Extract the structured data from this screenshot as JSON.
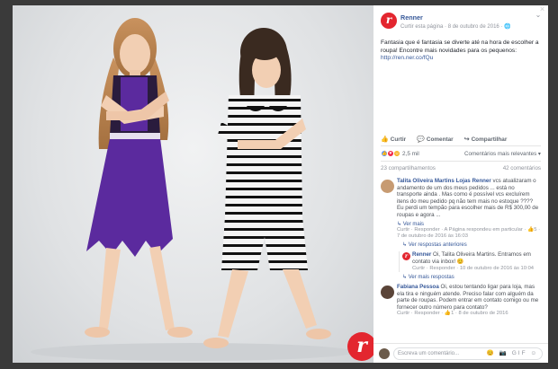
{
  "post": {
    "page_name": "Renner",
    "meta": "Curtir esta página · 8 de outubro de 2016 · ",
    "text_prefix": "Fantasia que é fantasia se diverte até na hora de escolher a roupa! Encontre mais novidades para os pequenos: ",
    "link": "http://ren.ner.co/fQu",
    "brand_letter": "r"
  },
  "actions": {
    "like": "Curtir",
    "comment": "Comentar",
    "share": "Compartilhar"
  },
  "reactions": {
    "count": "2,5 mil",
    "sort": "Comentários mais relevantes ▾"
  },
  "stats": {
    "shares": "23 compartilhamentos",
    "comments": "42 comentários"
  },
  "comments": [
    {
      "author": "Talita Oliveira Martins Lojas Renner",
      "text": " vcs atualizaram o andamento de um dos meus pedidos ... está no transporte ainda . Mas como é possível vcs excluírem itens do meu pedido pq não tem mais no estoque ???? Eu perdi um tempão para escolher mais de R$ 300,00 de roupas e agora ...",
      "see_more": "Ver mais",
      "links": "Curtir · Responder · A Página respondeu em particular · ",
      "reactions": "5",
      "time": " · 7 de outubro de 2016 às 16:03",
      "prev_replies": "Ver respostas anteriores",
      "reply": {
        "author": "Renner",
        "text": " Oi, Talita Oliveira Martins. Entramos em contato via inbox! 😊",
        "links": "Curtir · Responder · 10 de outubro de 2016 às 10:04"
      },
      "more_replies": "Ver mais respostas"
    },
    {
      "author": "Fabiana Pessoa",
      "text": " Oi, estou tentando ligar para loja, mas ela tira e ninguém atende. Preciso falar com alguém da parte de roupas. Podem entrar em contato comigo ou me fornecer outro número para contato?",
      "links": "Curtir · Responder · ",
      "reactions": "1",
      "time": " · 8 de outubro de 2016"
    }
  ],
  "composer": {
    "placeholder": "Escreva um comentário...",
    "tools": "😊 📷 GIF ☺"
  },
  "colors": {
    "brand": "#e3262f",
    "link": "#365899",
    "dress": "#5b2a9e"
  }
}
